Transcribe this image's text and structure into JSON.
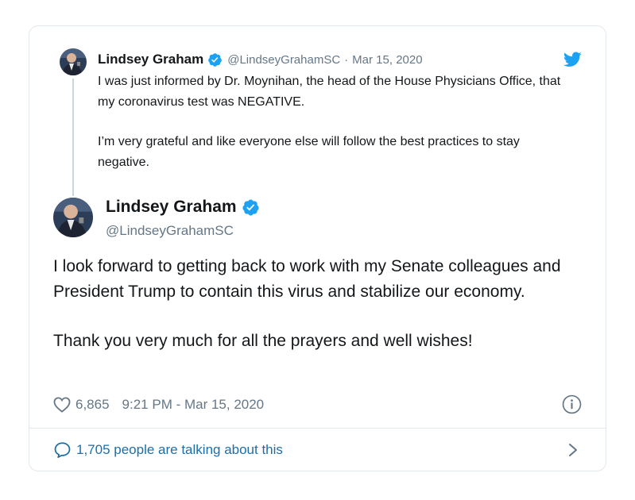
{
  "parent_tweet": {
    "author_name": "Lindsey Graham",
    "handle": "@LindseyGrahamSC",
    "separator": "·",
    "date": "Mar 15, 2020",
    "paragraphs": [
      "I was just informed by Dr. Moynihan, the head of the House Physicians Office, that my coronavirus test was NEGATIVE.",
      "I’m very grateful and like everyone else will follow the best practices to stay negative."
    ]
  },
  "main_tweet": {
    "author_name": "Lindsey Graham",
    "handle": "@LindseyGrahamSC",
    "paragraphs": [
      "I look forward to getting back to work with my Senate colleagues and President Trump to contain this virus and stabilize our economy.",
      "Thank you very much for all the prayers and well wishes!"
    ],
    "likes": "6,865",
    "timestamp": "9:21 PM - Mar 15, 2020"
  },
  "footer": {
    "talking_text": "1,705 people are talking about this"
  },
  "icons": {
    "verified": "verified-badge-icon",
    "brand": "twitter-bird-icon",
    "like": "heart-icon",
    "info": "info-icon",
    "reply": "reply-icon",
    "chevron": "chevron-right-icon"
  },
  "colors": {
    "twitter_blue": "#1da1f2",
    "link_blue": "#1b6ea8",
    "text": "#14171a",
    "muted": "#657786",
    "border": "#e1e8ed"
  }
}
